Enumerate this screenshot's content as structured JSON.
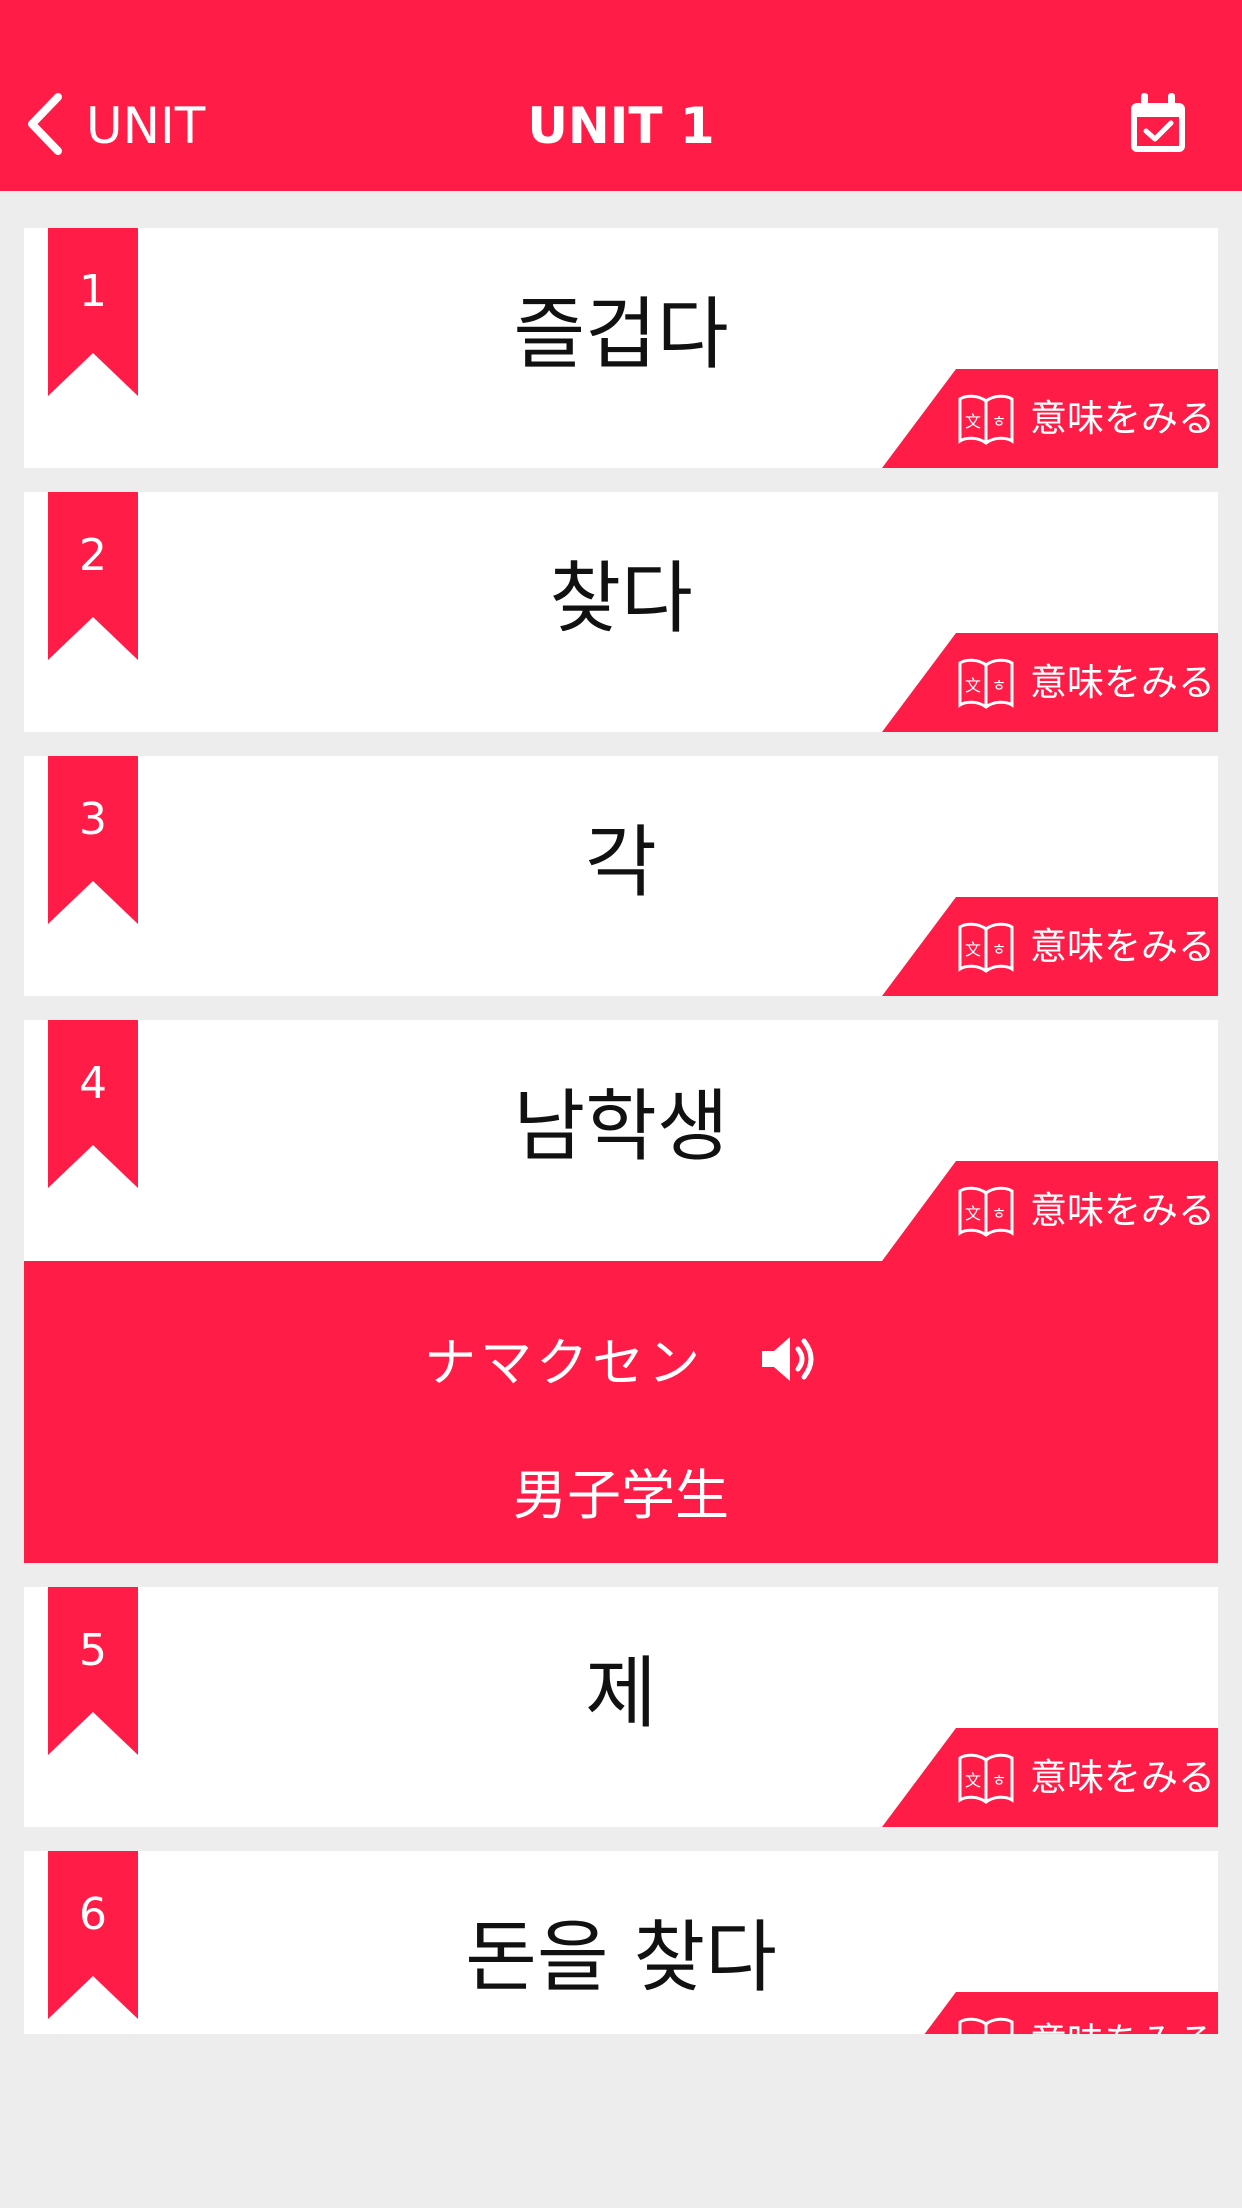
{
  "header": {
    "back_label": "UNIT",
    "title": "UNIT 1"
  },
  "colors": {
    "accent": "#ff1c46",
    "background": "#ededed",
    "card": "#ffffff"
  },
  "meaning_button_label": "意味をみる",
  "items": [
    {
      "num": "1",
      "word": "즐겁다"
    },
    {
      "num": "2",
      "word": "찾다"
    },
    {
      "num": "3",
      "word": "각"
    },
    {
      "num": "4",
      "word": "남학생",
      "reading": "ナマクセン",
      "translation": "男子学生"
    },
    {
      "num": "5",
      "word": "제"
    },
    {
      "num": "6",
      "word": "돈을 찾다"
    }
  ]
}
